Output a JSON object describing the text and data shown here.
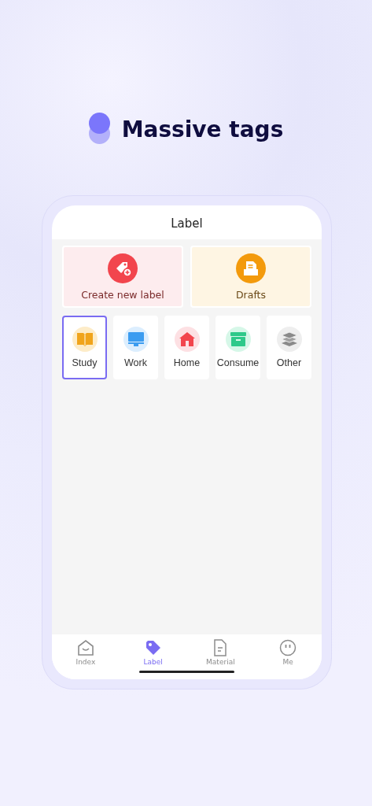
{
  "headline": "Massive tags",
  "screen": {
    "title": "Label",
    "actions": [
      {
        "kind": "create",
        "label": "Create new label"
      },
      {
        "kind": "drafts",
        "label": "Drafts"
      }
    ],
    "categories": [
      {
        "kind": "book",
        "label": "Study",
        "color": "#fdecc8",
        "selected": true
      },
      {
        "kind": "monitor",
        "label": "Work",
        "color": "#dceefe",
        "selected": false
      },
      {
        "kind": "house",
        "label": "Home",
        "color": "#fde0e3",
        "selected": false
      },
      {
        "kind": "box",
        "label": "Consume",
        "color": "#d6f7e8",
        "selected": false
      },
      {
        "kind": "layers",
        "label": "Other",
        "color": "#eeeeee",
        "selected": false
      }
    ],
    "tabs": [
      {
        "kind": "home",
        "label": "Index",
        "selected": false
      },
      {
        "kind": "tag",
        "label": "Label",
        "selected": true
      },
      {
        "kind": "document",
        "label": "Material",
        "selected": false
      },
      {
        "kind": "face",
        "label": "Me",
        "selected": false
      }
    ]
  }
}
